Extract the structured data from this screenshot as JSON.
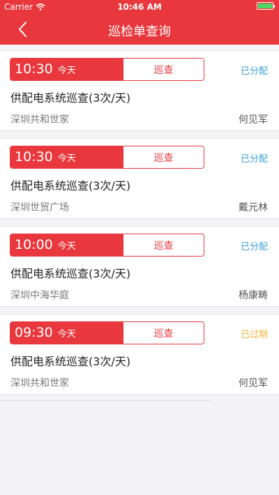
{
  "status_bar": {
    "carrier": "Carrier",
    "time": "10:46 AM"
  },
  "nav": {
    "title": "巡检单查询"
  },
  "records": [
    {
      "time": "10:30",
      "day": "今天",
      "type": "巡查",
      "status": "已分配",
      "title": "供配电系统巡查(3次/天)",
      "location": "深圳共和世家",
      "person": "何见军"
    },
    {
      "time": "10:30",
      "day": "今天",
      "type": "巡查",
      "status": "已分配",
      "title": "供配电系统巡查(3次/天)",
      "location": "深圳世贸广场",
      "person": "戴元林"
    },
    {
      "time": "10:00",
      "day": "今天",
      "type": "巡查",
      "status": "已分配",
      "title": "供配电系统巡查(3次/天)",
      "location": "深圳中海华庭",
      "person": "杨康畴"
    },
    {
      "time": "09:30",
      "day": "今天",
      "type": "巡查",
      "status": "已过期",
      "title": "供配电系统巡查(3次/天)",
      "location": "深圳共和世家",
      "person": "何见军"
    }
  ],
  "colors": {
    "primary": "#e8383d",
    "assigned": "#3a9fd6",
    "expired": "#f0b43c"
  },
  "icons": {
    "back": "chevron-left-icon",
    "wifi": "wifi-icon",
    "battery": "battery-icon"
  }
}
